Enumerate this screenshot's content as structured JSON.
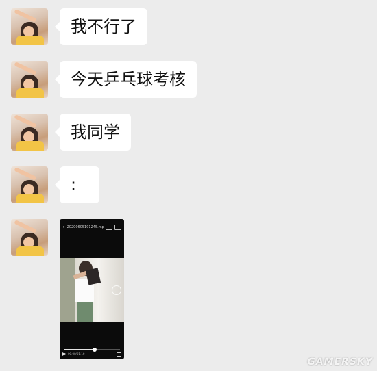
{
  "messages": [
    {
      "text": "我不行了"
    },
    {
      "text": "今天乒乓球考核"
    },
    {
      "text": "我同学"
    },
    {
      "text": ":"
    }
  ],
  "video": {
    "filename": "20200605101245.mp4",
    "time": "00:00/01:16",
    "progress": 0.55
  },
  "watermark": "GAMERSKY"
}
